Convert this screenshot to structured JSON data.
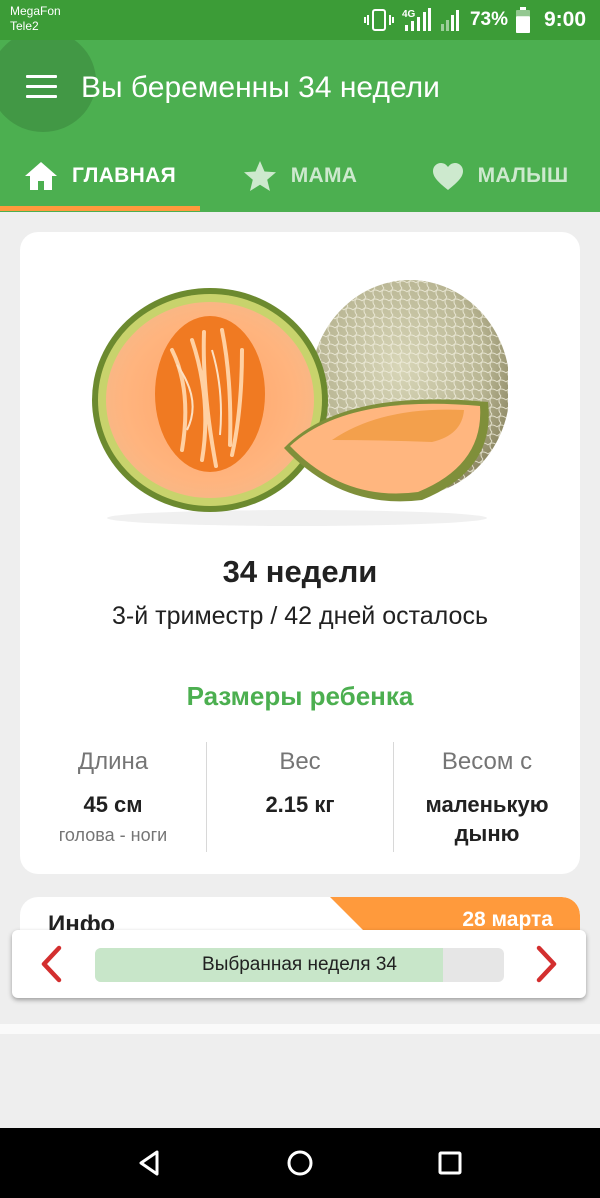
{
  "status": {
    "carrier1": "MegaFon",
    "carrier2": "Tele2",
    "network": "4G",
    "battery": "73%",
    "battery_level": 0.73,
    "time": "9:00"
  },
  "appbar": {
    "title": "Вы беременны 34 недели"
  },
  "tabs": [
    {
      "label": "ГЛАВНАЯ",
      "icon": "home-icon",
      "active": true
    },
    {
      "label": "МАМА",
      "icon": "star-icon",
      "active": false
    },
    {
      "label": "МАЛЫШ",
      "icon": "heart-icon",
      "active": false
    }
  ],
  "card": {
    "image": "cantaloupe-melon",
    "week_title": "34 недели",
    "trimester": "3-й триместр / 42 дней осталось",
    "sizes_title": "Размеры ребенка",
    "stats": [
      {
        "label": "Длина",
        "value": "45 см",
        "sub": "голова - ноги"
      },
      {
        "label": "Вес",
        "value": "2.15 кг",
        "sub": ""
      },
      {
        "label": "Весом с",
        "value": "маленькую дыню",
        "sub": ""
      }
    ]
  },
  "info_card": {
    "title": "Инфо",
    "date": "28 марта"
  },
  "week_selector": {
    "label": "Выбранная неделя 34",
    "week": 34,
    "total_weeks": 40
  },
  "colors": {
    "primary": "#4caf50",
    "status_bar": "#3c9c37",
    "accent": "#ff9a3c",
    "arrow": "#d32f2f",
    "progress_fill": "#c8e6c9"
  }
}
